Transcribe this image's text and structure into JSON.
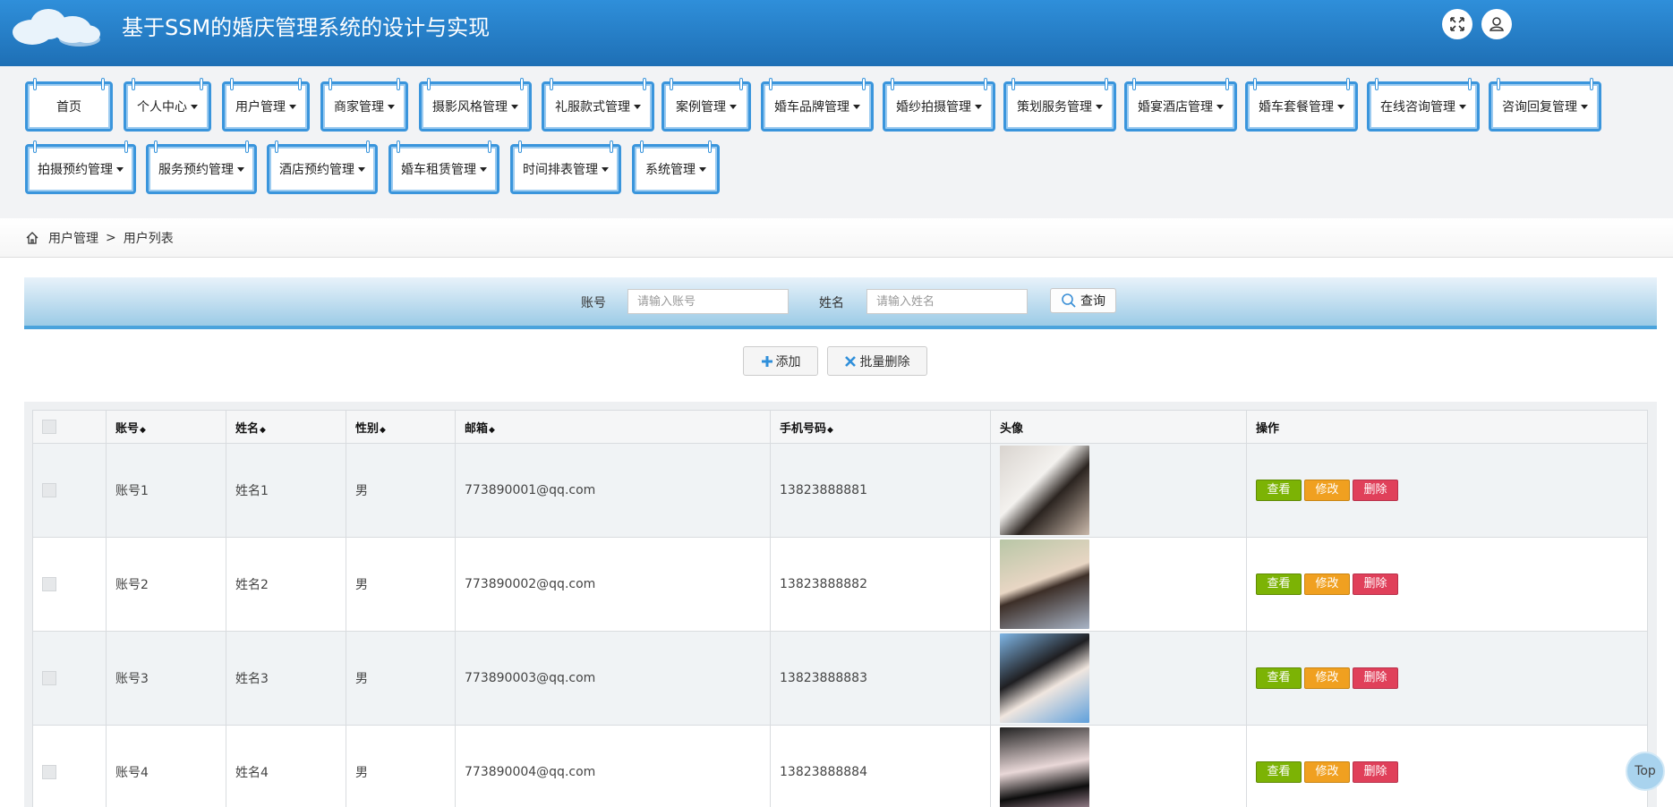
{
  "header": {
    "title": "基于SSM的婚庆管理系统的设计与实现"
  },
  "nav": {
    "row1": [
      {
        "label": "首页",
        "dropdown": false
      },
      {
        "label": "个人中心",
        "dropdown": true
      },
      {
        "label": "用户管理",
        "dropdown": true
      },
      {
        "label": "商家管理",
        "dropdown": true
      },
      {
        "label": "摄影风格管理",
        "dropdown": true
      },
      {
        "label": "礼服款式管理",
        "dropdown": true
      },
      {
        "label": "案例管理",
        "dropdown": true
      },
      {
        "label": "婚车品牌管理",
        "dropdown": true
      },
      {
        "label": "婚纱拍摄管理",
        "dropdown": true
      },
      {
        "label": "策划服务管理",
        "dropdown": true
      },
      {
        "label": "婚宴酒店管理",
        "dropdown": true
      },
      {
        "label": "婚车套餐管理",
        "dropdown": true
      },
      {
        "label": "在线咨询管理",
        "dropdown": true
      },
      {
        "label": "咨询回复管理",
        "dropdown": true
      }
    ],
    "row2": [
      {
        "label": "拍摄预约管理",
        "dropdown": true
      },
      {
        "label": "服务预约管理",
        "dropdown": true
      },
      {
        "label": "酒店预约管理",
        "dropdown": true
      },
      {
        "label": "婚车租赁管理",
        "dropdown": true
      },
      {
        "label": "时间排表管理",
        "dropdown": true
      },
      {
        "label": "系统管理",
        "dropdown": true
      }
    ]
  },
  "breadcrumb": {
    "parent": "用户管理",
    "separator": ">",
    "current": "用户列表"
  },
  "search": {
    "account_label": "账号",
    "account_placeholder": "请输入账号",
    "name_label": "姓名",
    "name_placeholder": "请输入姓名",
    "button": "查询"
  },
  "actions": {
    "add": "添加",
    "batch_delete": "批量删除"
  },
  "table": {
    "headers": {
      "account": "账号",
      "name": "姓名",
      "gender": "性别",
      "email": "邮箱",
      "phone": "手机号码",
      "avatar": "头像",
      "ops": "操作"
    },
    "sort_icon": "◆",
    "rows": [
      {
        "account": "账号1",
        "name": "姓名1",
        "gender": "男",
        "email": "773890001@qq.com",
        "phone": "13823888881"
      },
      {
        "account": "账号2",
        "name": "姓名2",
        "gender": "男",
        "email": "773890002@qq.com",
        "phone": "13823888882"
      },
      {
        "account": "账号3",
        "name": "姓名3",
        "gender": "男",
        "email": "773890003@qq.com",
        "phone": "13823888883"
      },
      {
        "account": "账号4",
        "name": "姓名4",
        "gender": "男",
        "email": "773890004@qq.com",
        "phone": "13823888884"
      }
    ],
    "row_buttons": {
      "view": "查看",
      "edit": "修改",
      "delete": "删除"
    }
  },
  "top_button": "Top",
  "colors": {
    "header": "#2f8fda",
    "nav_border": "#3a95dc",
    "view": "#7cb305",
    "edit": "#f0a020",
    "delete": "#e0405a"
  }
}
